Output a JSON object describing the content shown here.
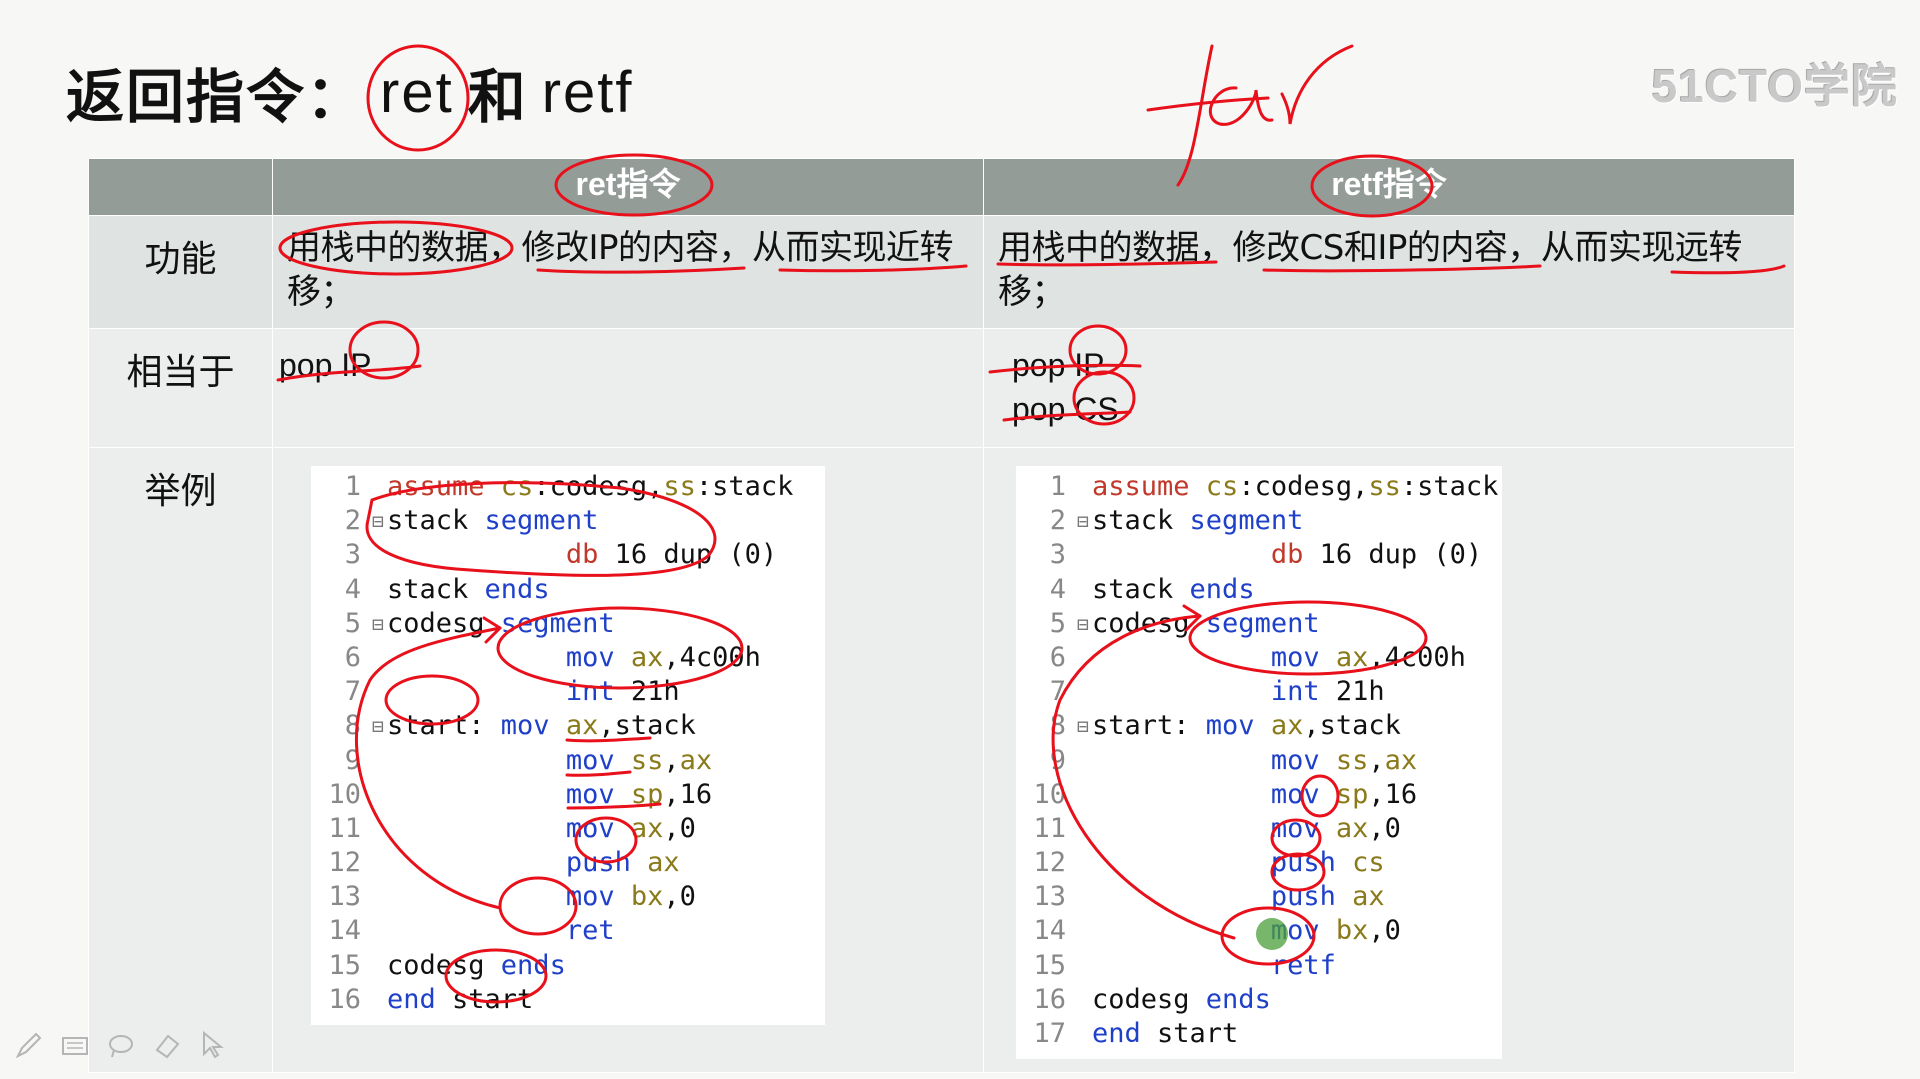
{
  "title": {
    "cn1": "返回指令：",
    "ret": "ret",
    "cn2": "和",
    "retf": "retf"
  },
  "watermark": "51CTO学院",
  "handwriting": "far",
  "table": {
    "headers": [
      "",
      "ret指令",
      "retf指令"
    ],
    "rows": {
      "function": {
        "label": "功能",
        "ret": "用栈中的数据，修改IP的内容，从而实现近转移；",
        "retf": "用栈中的数据，修改CS和IP的内容，从而实现远转移；"
      },
      "equivalent": {
        "label": "相当于",
        "ret": [
          "pop IP"
        ],
        "retf": [
          "pop IP",
          "pop CS"
        ]
      },
      "example": {
        "label": "举例"
      }
    }
  },
  "code_ret": [
    {
      "n": "1",
      "fold": "",
      "tokens": [
        [
          "r",
          "assume "
        ],
        [
          "o",
          "cs"
        ],
        [
          "d",
          ":codesg,"
        ],
        [
          "o",
          "ss"
        ],
        [
          "d",
          ":stack"
        ]
      ]
    },
    {
      "n": "2",
      "fold": "⊟",
      "tokens": [
        [
          "d",
          "stack "
        ],
        [
          "b",
          "segment"
        ]
      ]
    },
    {
      "n": "3",
      "fold": "",
      "tokens": [
        [
          "d",
          "           "
        ],
        [
          "r",
          "db"
        ],
        [
          "d",
          " 16 dup (0)"
        ]
      ]
    },
    {
      "n": "4",
      "fold": "",
      "tokens": [
        [
          "d",
          "stack "
        ],
        [
          "b",
          "ends"
        ]
      ]
    },
    {
      "n": "5",
      "fold": "⊟",
      "tokens": [
        [
          "d",
          "codesg "
        ],
        [
          "b",
          "segment"
        ]
      ]
    },
    {
      "n": "6",
      "fold": "",
      "tokens": [
        [
          "d",
          "           "
        ],
        [
          "b",
          "mov"
        ],
        [
          "d",
          " "
        ],
        [
          "o",
          "ax"
        ],
        [
          "d",
          ",4c00h"
        ]
      ]
    },
    {
      "n": "7",
      "fold": "",
      "tokens": [
        [
          "d",
          "           "
        ],
        [
          "b",
          "int"
        ],
        [
          "d",
          " 21h"
        ]
      ]
    },
    {
      "n": "8",
      "fold": "⊟",
      "tokens": [
        [
          "d",
          "start: "
        ],
        [
          "b",
          "mov"
        ],
        [
          "d",
          " "
        ],
        [
          "o",
          "ax"
        ],
        [
          "d",
          ",stack"
        ]
      ]
    },
    {
      "n": "9",
      "fold": "",
      "tokens": [
        [
          "d",
          "           "
        ],
        [
          "b",
          "mov"
        ],
        [
          "d",
          " "
        ],
        [
          "o",
          "ss"
        ],
        [
          "d",
          ","
        ],
        [
          "o",
          "ax"
        ]
      ]
    },
    {
      "n": "10",
      "fold": "",
      "tokens": [
        [
          "d",
          "           "
        ],
        [
          "b",
          "mov"
        ],
        [
          "d",
          " "
        ],
        [
          "o",
          "sp"
        ],
        [
          "d",
          ",16"
        ]
      ]
    },
    {
      "n": "11",
      "fold": "",
      "tokens": [
        [
          "d",
          "           "
        ],
        [
          "b",
          "mov"
        ],
        [
          "d",
          " "
        ],
        [
          "o",
          "ax"
        ],
        [
          "d",
          ",0"
        ]
      ]
    },
    {
      "n": "12",
      "fold": "",
      "tokens": [
        [
          "d",
          "           "
        ],
        [
          "b",
          "push"
        ],
        [
          "d",
          " "
        ],
        [
          "o",
          "ax"
        ]
      ]
    },
    {
      "n": "13",
      "fold": "",
      "tokens": [
        [
          "d",
          "           "
        ],
        [
          "b",
          "mov"
        ],
        [
          "d",
          " "
        ],
        [
          "o",
          "bx"
        ],
        [
          "d",
          ",0"
        ]
      ]
    },
    {
      "n": "14",
      "fold": "",
      "tokens": [
        [
          "d",
          "           "
        ],
        [
          "b",
          "ret"
        ]
      ]
    },
    {
      "n": "15",
      "fold": "",
      "tokens": [
        [
          "d",
          "codesg "
        ],
        [
          "b",
          "ends"
        ]
      ]
    },
    {
      "n": "16",
      "fold": "",
      "tokens": [
        [
          "b",
          "end"
        ],
        [
          "d",
          " start"
        ]
      ]
    }
  ],
  "code_retf": [
    {
      "n": "1",
      "fold": "",
      "tokens": [
        [
          "r",
          "assume "
        ],
        [
          "o",
          "cs"
        ],
        [
          "d",
          ":codesg,"
        ],
        [
          "o",
          "ss"
        ],
        [
          "d",
          ":stack"
        ]
      ]
    },
    {
      "n": "2",
      "fold": "⊟",
      "tokens": [
        [
          "d",
          "stack "
        ],
        [
          "b",
          "segment"
        ]
      ]
    },
    {
      "n": "3",
      "fold": "",
      "tokens": [
        [
          "d",
          "           "
        ],
        [
          "r",
          "db"
        ],
        [
          "d",
          " 16 dup (0)"
        ]
      ]
    },
    {
      "n": "4",
      "fold": "",
      "tokens": [
        [
          "d",
          "stack "
        ],
        [
          "b",
          "ends"
        ]
      ]
    },
    {
      "n": "5",
      "fold": "⊟",
      "tokens": [
        [
          "d",
          "codesg "
        ],
        [
          "b",
          "segment"
        ]
      ]
    },
    {
      "n": "6",
      "fold": "",
      "tokens": [
        [
          "d",
          "           "
        ],
        [
          "b",
          "mov"
        ],
        [
          "d",
          " "
        ],
        [
          "o",
          "ax"
        ],
        [
          "d",
          ",4c00h"
        ]
      ]
    },
    {
      "n": "7",
      "fold": "",
      "tokens": [
        [
          "d",
          "           "
        ],
        [
          "b",
          "int"
        ],
        [
          "d",
          " 21h"
        ]
      ]
    },
    {
      "n": "8",
      "fold": "⊟",
      "tokens": [
        [
          "d",
          "start: "
        ],
        [
          "b",
          "mov"
        ],
        [
          "d",
          " "
        ],
        [
          "o",
          "ax"
        ],
        [
          "d",
          ",stack"
        ]
      ]
    },
    {
      "n": "9",
      "fold": "",
      "tokens": [
        [
          "d",
          "           "
        ],
        [
          "b",
          "mov"
        ],
        [
          "d",
          " "
        ],
        [
          "o",
          "ss"
        ],
        [
          "d",
          ","
        ],
        [
          "o",
          "ax"
        ]
      ]
    },
    {
      "n": "10",
      "fold": "",
      "tokens": [
        [
          "d",
          "           "
        ],
        [
          "b",
          "mov"
        ],
        [
          "d",
          " "
        ],
        [
          "o",
          "sp"
        ],
        [
          "d",
          ",16"
        ]
      ]
    },
    {
      "n": "11",
      "fold": "",
      "tokens": [
        [
          "d",
          "           "
        ],
        [
          "b",
          "mov"
        ],
        [
          "d",
          " "
        ],
        [
          "o",
          "ax"
        ],
        [
          "d",
          ",0"
        ]
      ]
    },
    {
      "n": "12",
      "fold": "",
      "tokens": [
        [
          "d",
          "           "
        ],
        [
          "b",
          "push"
        ],
        [
          "d",
          " "
        ],
        [
          "o",
          "cs"
        ]
      ]
    },
    {
      "n": "13",
      "fold": "",
      "tokens": [
        [
          "d",
          "           "
        ],
        [
          "b",
          "push"
        ],
        [
          "d",
          " "
        ],
        [
          "o",
          "ax"
        ]
      ]
    },
    {
      "n": "14",
      "fold": "",
      "tokens": [
        [
          "d",
          "           "
        ],
        [
          "b",
          "mov"
        ],
        [
          "d",
          " "
        ],
        [
          "o",
          "bx"
        ],
        [
          "d",
          ",0"
        ]
      ]
    },
    {
      "n": "15",
      "fold": "",
      "tokens": [
        [
          "d",
          "           "
        ],
        [
          "b",
          "retf"
        ]
      ]
    },
    {
      "n": "16",
      "fold": "",
      "tokens": [
        [
          "d",
          "codesg "
        ],
        [
          "b",
          "ends"
        ]
      ]
    },
    {
      "n": "17",
      "fold": "",
      "tokens": [
        [
          "b",
          "end"
        ],
        [
          "d",
          " start"
        ]
      ]
    }
  ],
  "toolbar": [
    "pen-icon",
    "keyboard-icon",
    "lasso-icon",
    "eraser-icon",
    "pointer-icon"
  ],
  "colors": {
    "header_bg": "#949c98",
    "ink": "#e8101a",
    "keyword_blue": "#1f40c8",
    "keyword_red": "#c0392b",
    "register": "#8a7a1a"
  }
}
